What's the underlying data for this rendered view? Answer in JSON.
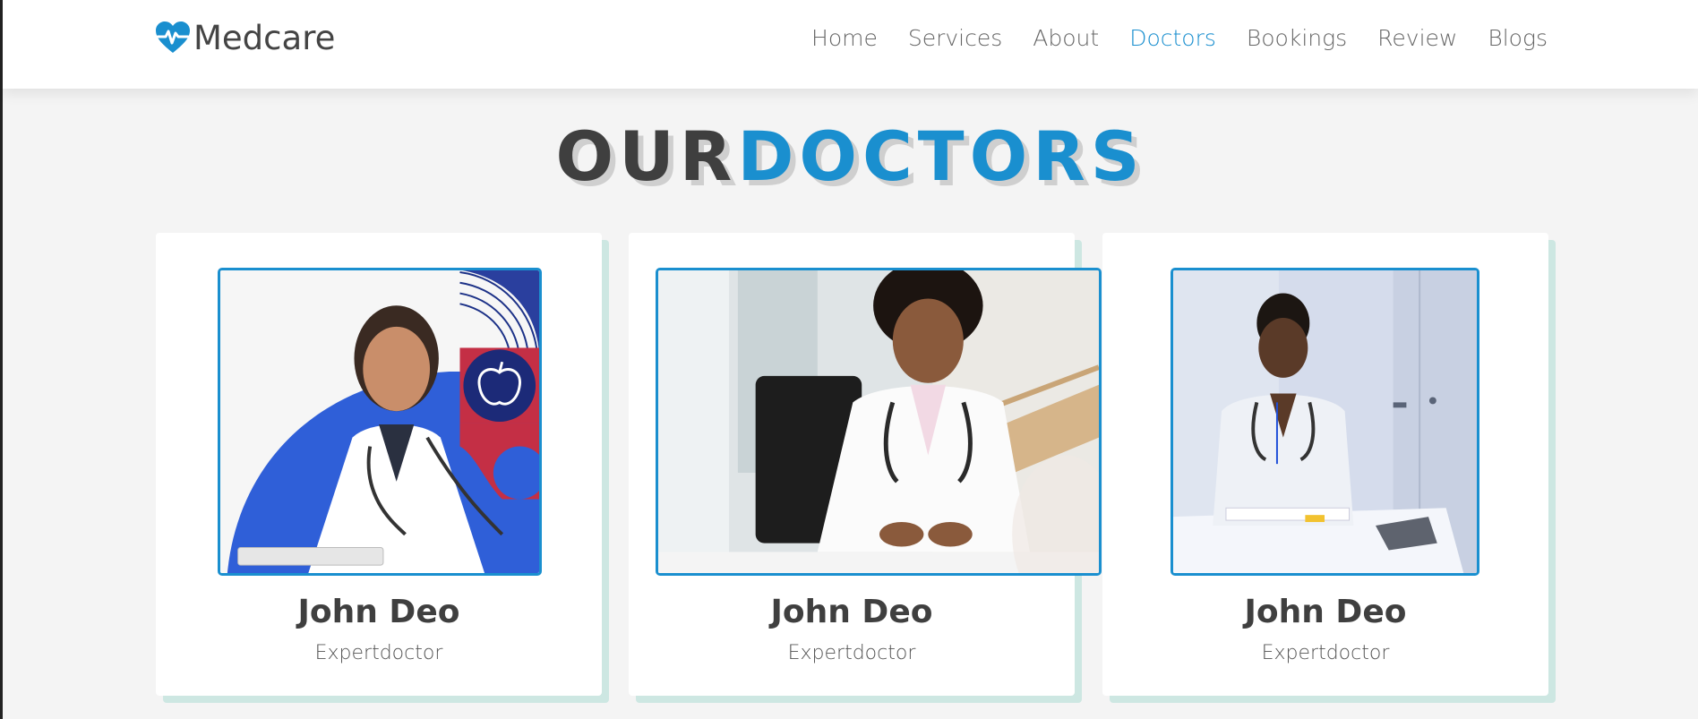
{
  "brand": {
    "name": "Medcare",
    "icon": "heart-pulse-icon",
    "color": "#1a8fcf"
  },
  "nav": {
    "items": [
      {
        "label": "Home"
      },
      {
        "label": "Services"
      },
      {
        "label": "About"
      },
      {
        "label": "Doctors",
        "active": true
      },
      {
        "label": "Bookings"
      },
      {
        "label": "Review"
      },
      {
        "label": "Blogs"
      }
    ]
  },
  "section": {
    "title_part1": "OUR",
    "title_part2": "DOCTORS"
  },
  "doctors": [
    {
      "name": "John Deo",
      "title": "Expertdoctor"
    },
    {
      "name": "John Deo",
      "title": "Expertdoctor"
    },
    {
      "name": "John Deo",
      "title": "Expertdoctor"
    }
  ],
  "colors": {
    "accent": "#1a8fcf",
    "heading_dark": "#3f3f3f",
    "card_shadow": "#cde7e2",
    "page_bg": "#f4f4f4"
  }
}
